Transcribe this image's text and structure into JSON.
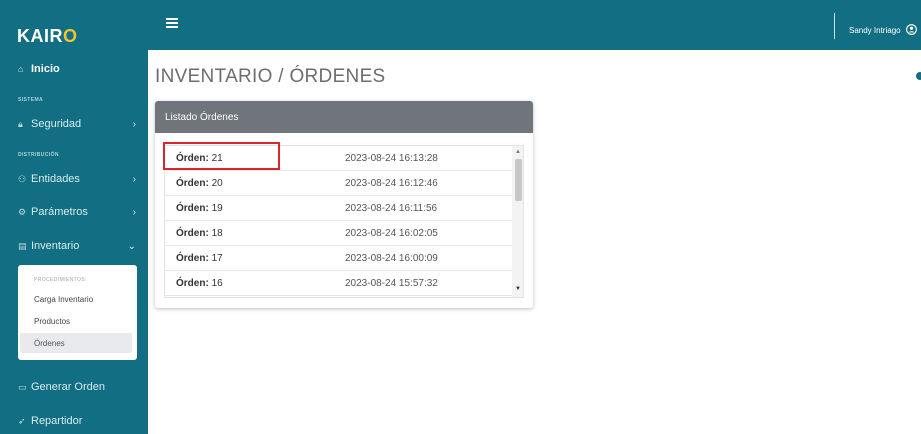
{
  "app": {
    "brand_prefix": "KAIR",
    "brand_accent": "O"
  },
  "header": {
    "menu_icon": "hamburger-icon",
    "user_name": "Sandy Intriago",
    "user_icon": "user-circle-icon"
  },
  "sidebar": {
    "home": {
      "label": "Inicio",
      "icon": "home-icon"
    },
    "sections": {
      "sistema": "SISTEMA",
      "distribucion": "DISTRIBUCIÓN"
    },
    "seguridad": {
      "label": "Seguridad",
      "icon": "lock-icon"
    },
    "entidades": {
      "label": "Entidades",
      "icon": "users-icon"
    },
    "parametros": {
      "label": "Parámetros",
      "icon": "sliders-icon"
    },
    "inventario": {
      "label": "Inventario",
      "icon": "list-icon"
    },
    "submenu": {
      "title": "PROCEDIMIENTOS:",
      "items": [
        "Carga Inventario",
        "Productos",
        "Órdenes"
      ]
    },
    "generar_orden": {
      "label": "Generar Orden",
      "icon": "cart-icon"
    },
    "repartidor": {
      "label": "Repartidor",
      "icon": "send-icon"
    },
    "chevron_right": "›",
    "chevron_down": "⌄"
  },
  "main": {
    "page_title": "INVENTARIO / ÓRDENES",
    "card_title": "Listado Órdenes",
    "order_prefix": "Órden:",
    "orders": [
      {
        "number": "21",
        "datetime": "2023-08-24 16:13:28"
      },
      {
        "number": "20",
        "datetime": "2023-08-24 16:12:46"
      },
      {
        "number": "19",
        "datetime": "2023-08-24 16:11:56"
      },
      {
        "number": "18",
        "datetime": "2023-08-24 16:02:05"
      },
      {
        "number": "17",
        "datetime": "2023-08-24 16:00:09"
      },
      {
        "number": "16",
        "datetime": "2023-08-24 15:57:32"
      }
    ]
  },
  "colors": {
    "primary": "#126e82",
    "accent": "#f4c430",
    "header_card": "#6f757a",
    "highlight": "#d8262b"
  }
}
